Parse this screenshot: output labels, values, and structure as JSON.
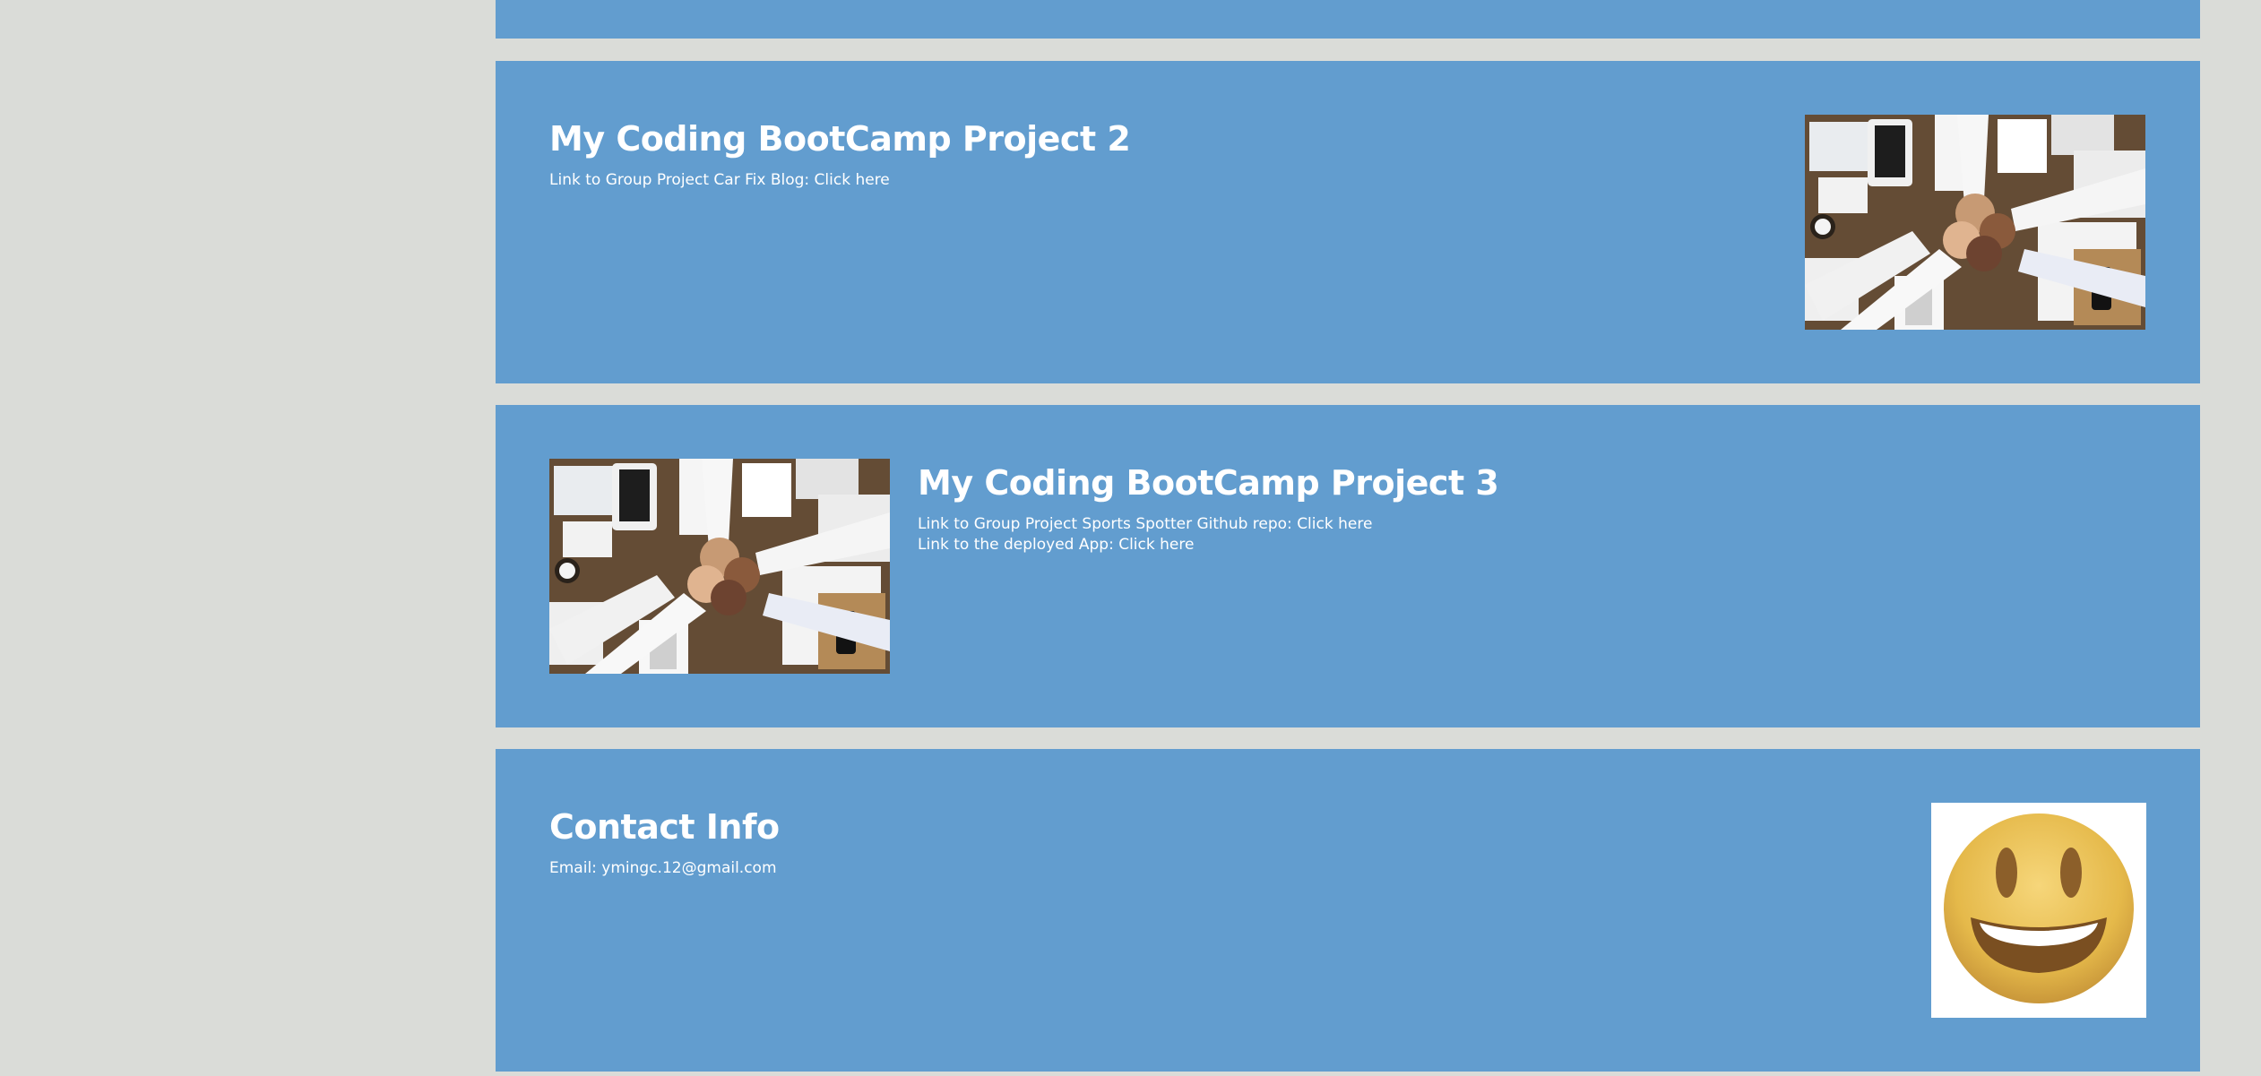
{
  "projects": [
    {
      "title": "My Coding BootCamp Project 2",
      "links": [
        {
          "prefix": "Link to Group Project Car Fix Blog: ",
          "link_text": "Click here"
        }
      ]
    },
    {
      "title": "My Coding BootCamp Project 3",
      "links": [
        {
          "prefix": "Link to Group Project Sports Spotter Github repo: ",
          "link_text": "Click here"
        },
        {
          "prefix": "Link to the deployed App: ",
          "link_text": "Click here"
        }
      ]
    }
  ],
  "contact": {
    "title": "Contact Info",
    "email_label": "Email: ",
    "email": "ymingc.12@gmail.com"
  },
  "images": {
    "project_photo": "teamwork-fist-bump-photo",
    "contact_image": "smiley-face-emoji"
  },
  "colors": {
    "page_background": "#dadcd8",
    "panel_background": "#629dcf",
    "text": "#ffffff"
  }
}
